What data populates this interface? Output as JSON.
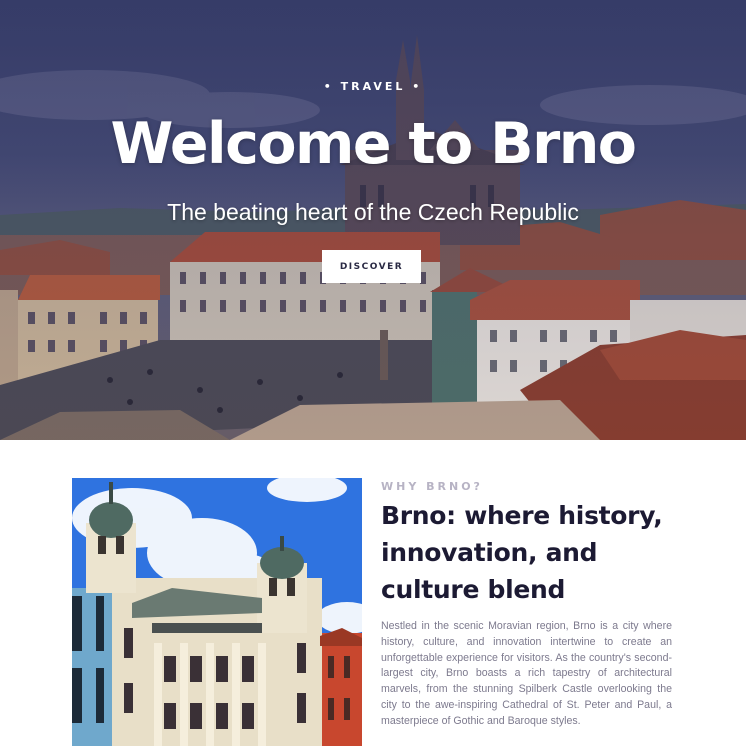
{
  "hero": {
    "eyebrow": "• TRAVEL •",
    "title": "Welcome to Brno",
    "subtitle": "The beating heart of the Czech Republic",
    "cta_label": "DISCOVER",
    "image_alt": "Aerial view of Brno city center with cathedral"
  },
  "about": {
    "eyebrow": "WHY BRNO?",
    "title": "Brno: where history, innovation, and culture blend",
    "body": "Nestled in the scenic Moravian region, Brno is a city where history, culture, and innovation intertwine to create an unforgettable experience for visitors. As the country's second-largest city, Brno boasts a rich tapestry of architectural marvels, from the stunning Spilberk Castle overlooking the city to the awe-inspiring Cathedral of St. Peter and Paul, a masterpiece of Gothic and Baroque styles.",
    "image_alt": "Ornate historic building facade in Brno"
  },
  "colors": {
    "heading": "#1c1a33",
    "eyebrow": "#b7b3c4",
    "body_text": "#7d7a8e",
    "hero_overlay": "#39406a",
    "button_bg": "#ffffff"
  }
}
